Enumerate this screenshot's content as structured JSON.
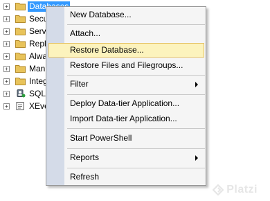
{
  "tree": {
    "items": [
      {
        "label": "Databases",
        "icon": "folder-icon",
        "expander": "+",
        "selected": true
      },
      {
        "label": "Secu",
        "icon": "folder-icon",
        "expander": "+"
      },
      {
        "label": "Serv",
        "icon": "folder-icon",
        "expander": "+"
      },
      {
        "label": "Repl",
        "icon": "folder-icon",
        "expander": "+"
      },
      {
        "label": "Alwa",
        "icon": "folder-icon",
        "expander": "+"
      },
      {
        "label": "Man",
        "icon": "folder-icon",
        "expander": "+"
      },
      {
        "label": "Integ",
        "icon": "folder-icon",
        "expander": "+"
      },
      {
        "label": "SQL",
        "icon": "sql-agent-icon",
        "expander": "+"
      },
      {
        "label": "XEve",
        "icon": "xevent-profiler-icon",
        "expander": "+"
      }
    ]
  },
  "menu": {
    "items": [
      {
        "label": "New Database..."
      },
      {
        "label": "Attach..."
      },
      {
        "label": "Restore Database...",
        "highlighted": true
      },
      {
        "label": "Restore Files and Filegroups..."
      },
      {
        "label": "Filter",
        "submenu": true
      },
      {
        "label": "Deploy Data-tier Application..."
      },
      {
        "label": "Import Data-tier Application..."
      },
      {
        "label": "Start PowerShell"
      },
      {
        "label": "Reports",
        "submenu": true
      },
      {
        "label": "Refresh"
      }
    ]
  },
  "watermark": {
    "text": "Platzi",
    "icon": "platzi-logo-icon"
  },
  "colors": {
    "selection": "#3399ff",
    "menu_background": "#f5f5f5",
    "menu_gutter": "#d4dbe8",
    "highlight_fill": "#fcf3bd",
    "highlight_border": "#e5c365",
    "folder": "#e8c35a"
  }
}
